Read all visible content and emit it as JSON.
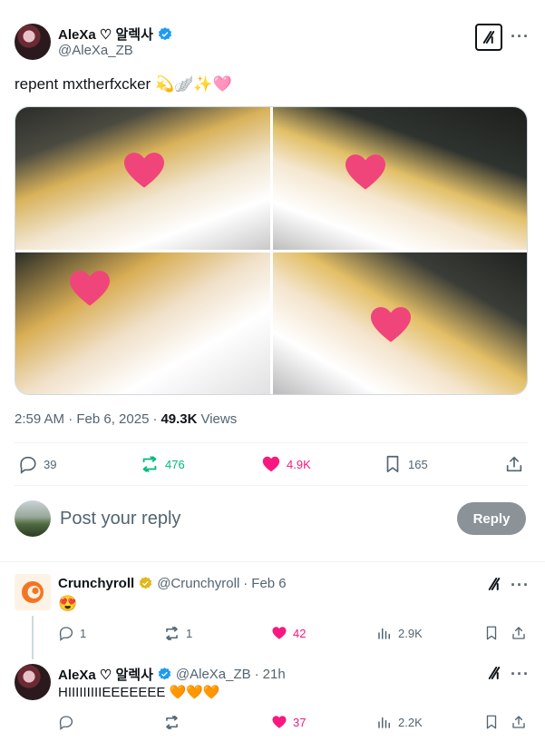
{
  "tweet": {
    "display_name": "AleXa ♡ 알렉사",
    "handle": "@AleXa_ZB",
    "text": "repent mxtherfxcker 💫🪽✨🩷",
    "timestamp": "2:59 AM · Feb 6, 2025",
    "views_count": "49.3K",
    "views_label": "Views",
    "replies": "39",
    "reposts": "476",
    "likes": "4.9K",
    "bookmarks": "165"
  },
  "composer": {
    "placeholder": "Post your reply",
    "button": "Reply"
  },
  "replies": [
    {
      "display_name": "Crunchyroll",
      "handle": "@Crunchyroll",
      "time": "Feb 6",
      "text": "😍",
      "replies": "1",
      "reposts": "1",
      "likes": "42",
      "views": "2.9K"
    },
    {
      "display_name": "AleXa ♡ 알렉사",
      "handle": "@AleXa_ZB",
      "time": "21h",
      "text": "HIIIIIIIIIEEEEEEE 🧡🧡🧡",
      "replies": "",
      "reposts": "",
      "likes": "37",
      "views": "2.2K"
    }
  ],
  "colors": {
    "verified": "#1d9bf0",
    "verified_gold": "#e2b719",
    "repost_active": "#00ba7c",
    "like_active": "#f91880",
    "text_muted": "#536471"
  },
  "icons": {
    "verified": "verified-badge-icon",
    "grok": "grok-icon",
    "more": "more-icon",
    "reply": "reply-icon",
    "repost": "repost-icon",
    "like": "heart-icon",
    "bookmark": "bookmark-icon",
    "share": "share-icon",
    "views": "views-icon"
  }
}
